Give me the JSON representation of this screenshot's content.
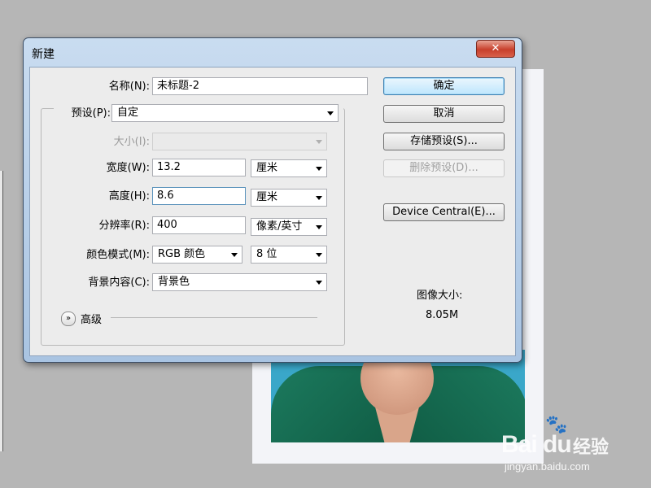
{
  "dialog": {
    "title": "新建",
    "close_glyph": "✕",
    "name_label": "名称(N):",
    "name_value": "未标题-2",
    "preset_label": "预设(P):",
    "preset_value": "自定",
    "size_label": "大小(I):",
    "size_value": "",
    "width_label": "宽度(W):",
    "width_value": "13.2",
    "width_unit": "厘米",
    "height_label": "高度(H):",
    "height_value": "8.6",
    "height_unit": "厘米",
    "resolution_label": "分辨率(R):",
    "resolution_value": "400",
    "resolution_unit": "像素/英寸",
    "color_mode_label": "颜色模式(M):",
    "color_mode_value": "RGB 颜色",
    "bit_depth_value": "8 位",
    "background_label": "背景内容(C):",
    "background_value": "背景色",
    "advanced_label": "高级",
    "image_size_label": "图像大小:",
    "image_size_value": "8.05M"
  },
  "buttons": {
    "ok": "确定",
    "cancel": "取消",
    "save_preset": "存储预设(S)...",
    "delete_preset": "删除预设(D)...",
    "device_central": "Device Central(E)..."
  },
  "watermark": {
    "brand": "Bai du",
    "paw": "🐾",
    "cn": "经验",
    "url": "jingyan.baidu.com"
  },
  "icons": {
    "expand": "chevron-double-down-icon",
    "dropdown": "chevron-down-icon",
    "close": "close-icon"
  },
  "colors": {
    "dialog_frame": "#a9c4e2",
    "close_button": "#c7402c",
    "default_button": "#bee6fd",
    "photo_background": "#3aa7c9",
    "jacket": "#1c7a5e"
  }
}
